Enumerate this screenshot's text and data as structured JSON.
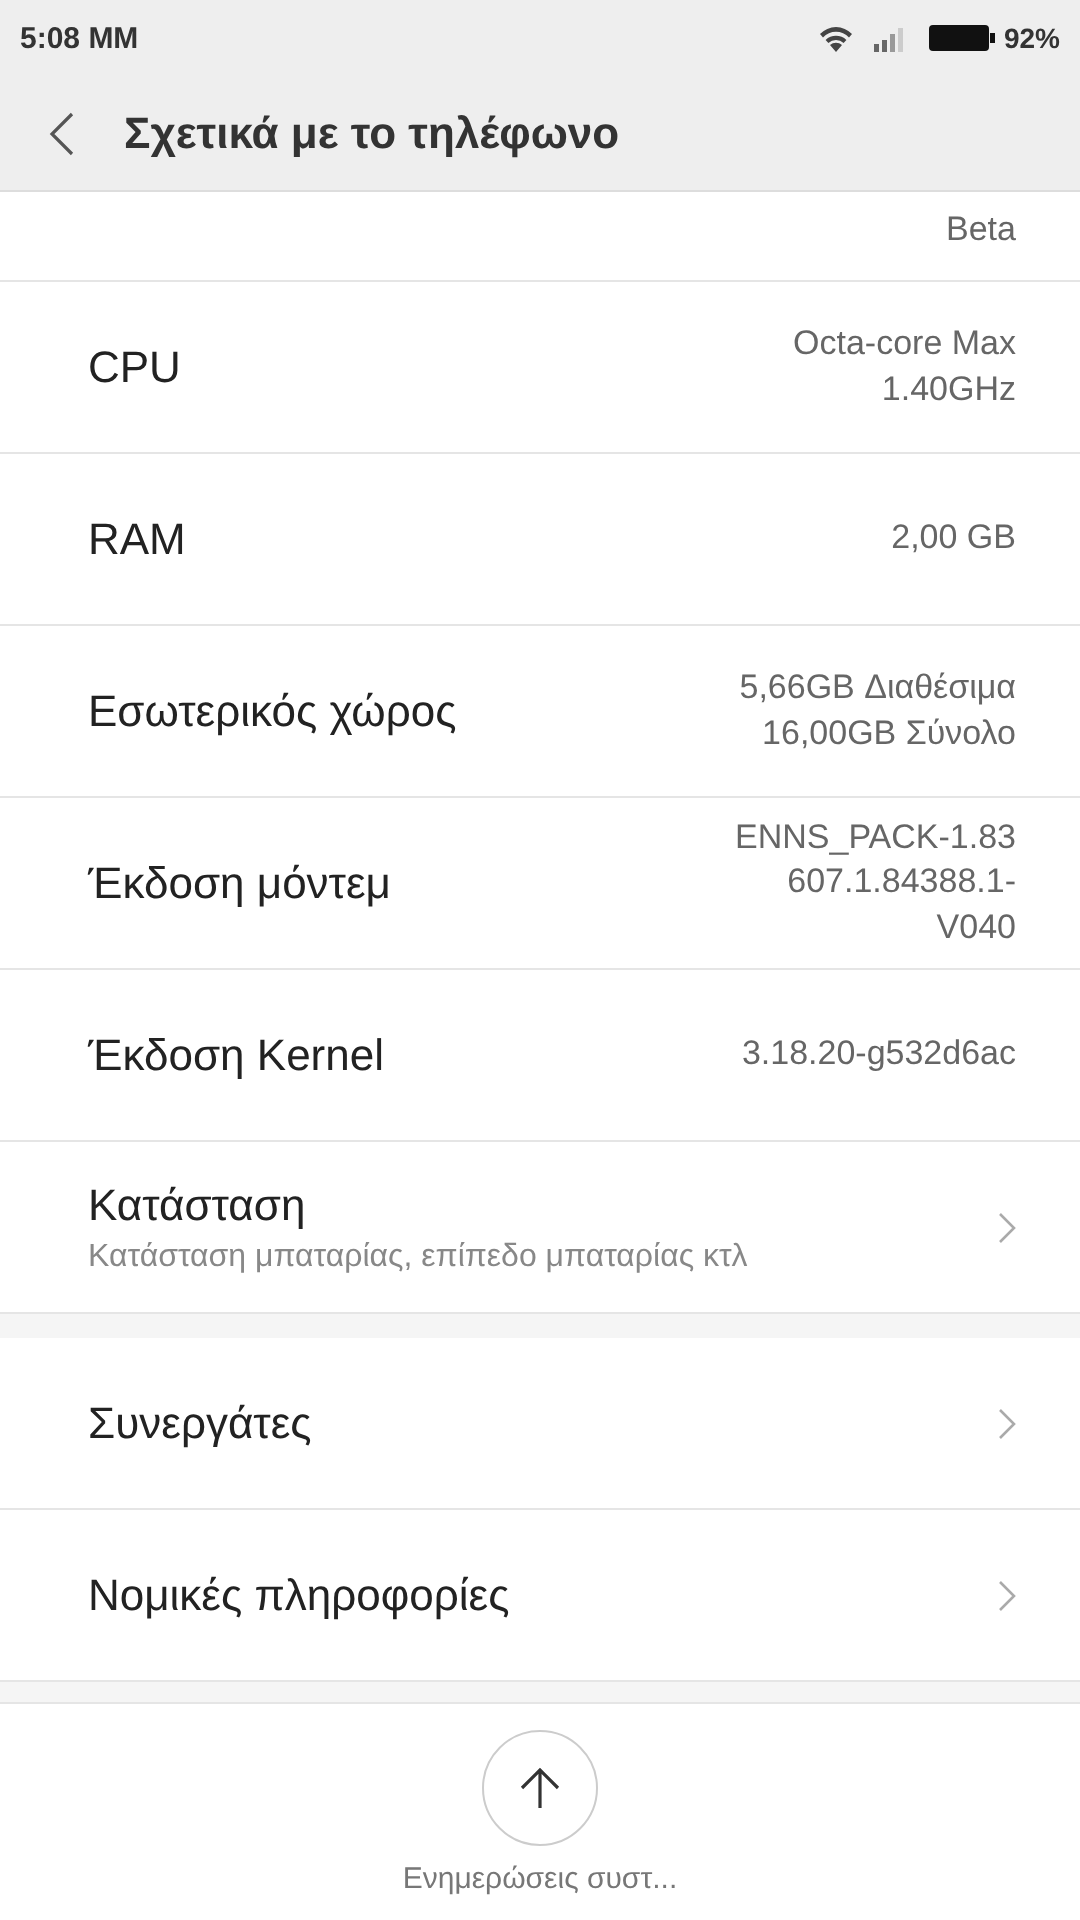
{
  "status_bar": {
    "time": "5:08 MM",
    "battery": "92%"
  },
  "header": {
    "title": "Σχετικά με το τηλέφωνο"
  },
  "sections": [
    {
      "rows": [
        {
          "kind": "partial",
          "value": "Beta"
        },
        {
          "kind": "info",
          "label": "CPU",
          "value": "Octa-core Max\n1.40GHz"
        },
        {
          "kind": "info",
          "label": "RAM",
          "value": "2,00 GB"
        },
        {
          "kind": "info",
          "label": "Εσωτερικός χώρος",
          "value": "5,66GB Διαθέσιμα\n16,00GB Σύνολο"
        },
        {
          "kind": "info",
          "label": "Έκδοση μόντεμ",
          "value": "ENNS_PACK-1.83\n607.1.84388.1-\nV040"
        },
        {
          "kind": "info",
          "label": "Έκδοση Kernel",
          "value": "3.18.20-g532d6ac"
        },
        {
          "kind": "link",
          "label": "Κατάσταση",
          "subtitle": "Κατάσταση μπαταρίας, επίπεδο μπαταρίας κτλ"
        }
      ]
    },
    {
      "rows": [
        {
          "kind": "link",
          "label": "Συνεργάτες"
        },
        {
          "kind": "link",
          "label": "Νομικές πληροφορίες"
        }
      ]
    }
  ],
  "bottom_action": {
    "label": "Ενημερώσεις συστ..."
  }
}
